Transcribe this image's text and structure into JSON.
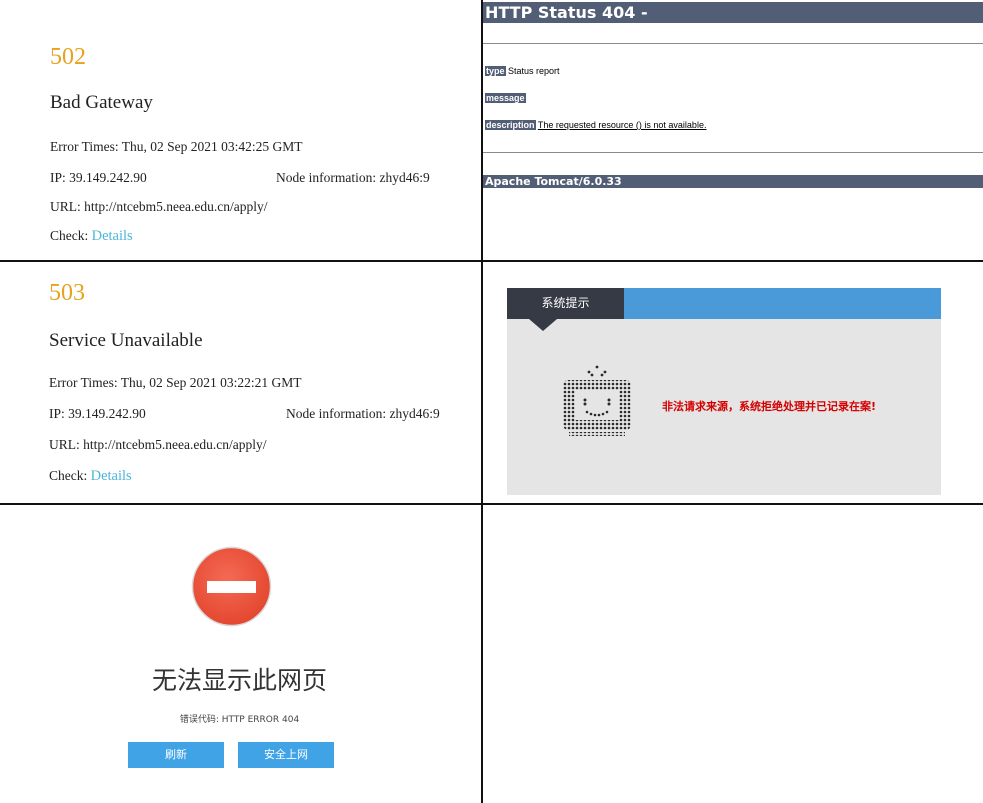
{
  "panel_502": {
    "code": "502",
    "title": "Bad Gateway",
    "error_times": "Error Times: Thu, 02 Sep 2021 03:42:25 GMT",
    "ip": "IP: 39.149.242.90",
    "node": "Node information: zhyd46:9",
    "url": "URL: http://ntcebm5.neea.edu.cn/apply/",
    "check_label": "Check: ",
    "check_link": "Details"
  },
  "panel_503": {
    "code": "503",
    "title": "Service Unavailable",
    "error_times": "Error Times: Thu, 02 Sep 2021 03:22:21 GMT",
    "ip": "IP: 39.149.242.90",
    "node": "Node information: zhyd46:9",
    "url": "URL: http://ntcebm5.neea.edu.cn/apply/",
    "check_label": "Check: ",
    "check_link": "Details"
  },
  "panel_tomcat": {
    "heading": "HTTP Status 404 -",
    "type_label": "type",
    "type_value": " Status report",
    "message_label": "message",
    "description_label": "description",
    "description_value": "The requested resource () is not available.",
    "footer": "Apache Tomcat/6.0.33",
    "bar_color": "#525d76"
  },
  "panel_system": {
    "tab_label": "系统提示",
    "icon": "tv-smiley-icon",
    "message": "非法请求来源，系统拒绝处理并已记录在案!",
    "message_color": "#d40000"
  },
  "panel_cannot_display": {
    "icon": "no-entry-icon",
    "title": "无法显示此网页",
    "error_code": "错误代码:   HTTP ERROR 404",
    "refresh_button": "刷新",
    "safe_browse_button": "安全上网",
    "button_color": "#3fa3e6"
  }
}
